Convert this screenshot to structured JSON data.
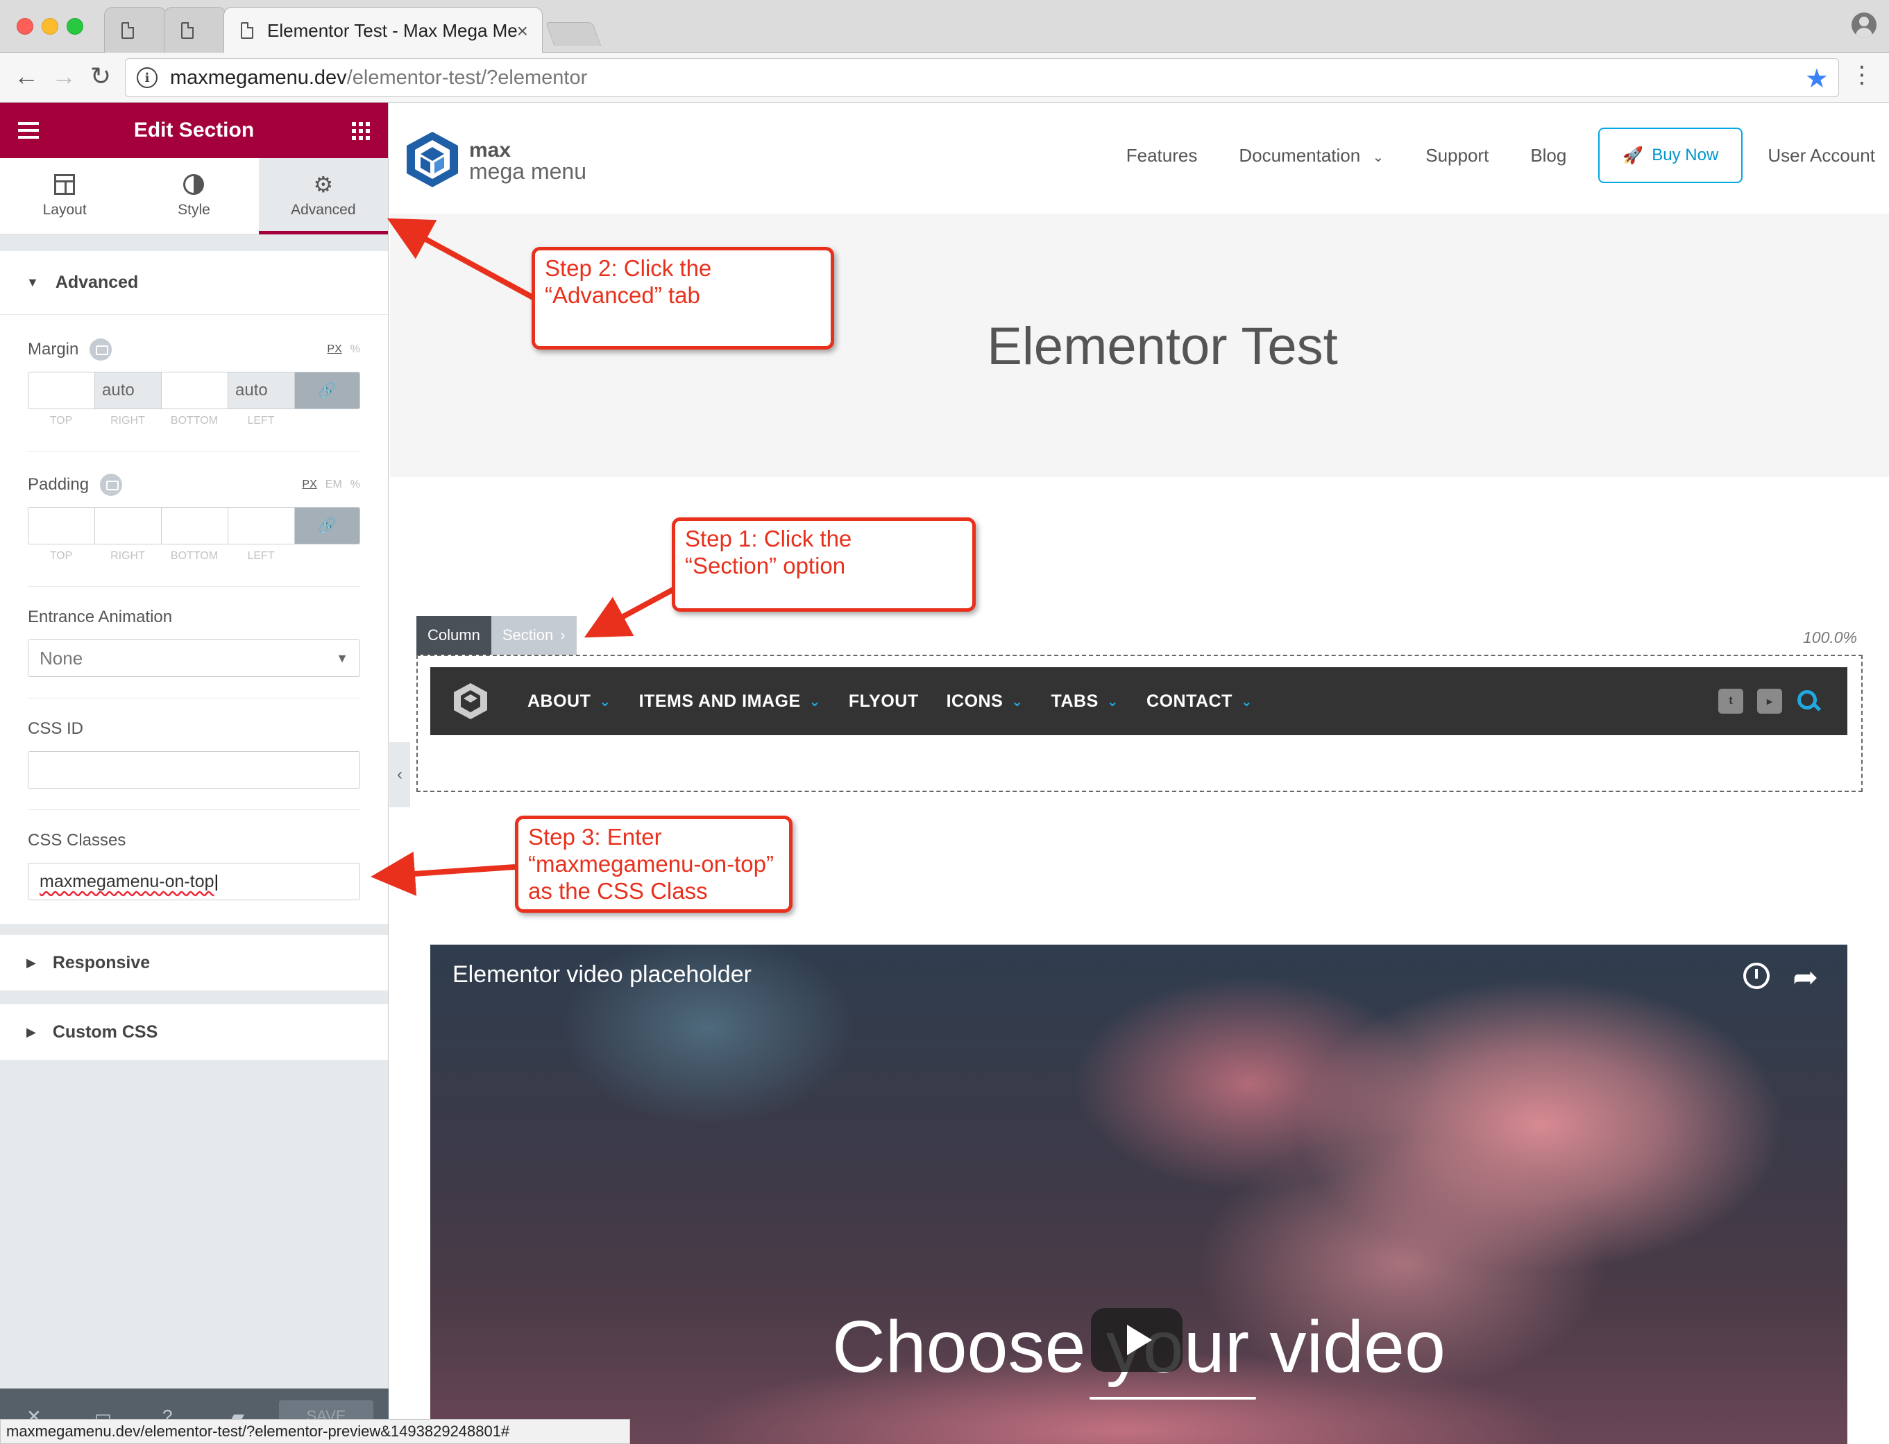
{
  "browser": {
    "tabs": [
      {
        "title": ""
      },
      {
        "title": ""
      },
      {
        "title": "Elementor Test - Max Mega Me"
      }
    ],
    "url_domain": "maxmegamenu.dev",
    "url_path": "/elementor-test/?elementor",
    "status_url": "maxmegamenu.dev/elementor-test/?elementor-preview&1493829248801#"
  },
  "panel": {
    "title": "Edit Section",
    "tabs": [
      {
        "label": "Layout",
        "icon": "layout-icon"
      },
      {
        "label": "Style",
        "icon": "style-icon"
      },
      {
        "label": "Advanced",
        "icon": "gear-icon",
        "active": true
      }
    ],
    "advanced_section": "Advanced",
    "margin": {
      "label": "Margin",
      "units": [
        "PX",
        "%"
      ],
      "values": [
        "",
        "auto",
        "",
        "auto"
      ],
      "sides": [
        "TOP",
        "RIGHT",
        "BOTTOM",
        "LEFT"
      ]
    },
    "padding": {
      "label": "Padding",
      "units": [
        "PX",
        "EM",
        "%"
      ],
      "values": [
        "",
        "",
        "",
        ""
      ],
      "sides": [
        "TOP",
        "RIGHT",
        "BOTTOM",
        "LEFT"
      ]
    },
    "entrance_animation": {
      "label": "Entrance Animation",
      "value": "None"
    },
    "css_id": {
      "label": "CSS ID",
      "value": ""
    },
    "css_classes": {
      "label": "CSS Classes",
      "value": "maxmegamenu-on-top"
    },
    "responsive_section": "Responsive",
    "custom_css_section": "Custom CSS",
    "footer": {
      "save_label": "SAVE"
    }
  },
  "site": {
    "logo_line1": "max",
    "logo_line2": "mega menu",
    "nav": [
      "Features",
      "Documentation",
      "Support",
      "Blog"
    ],
    "buy_now": "Buy Now",
    "user_account": "User Account",
    "page_title": "Elementor Test"
  },
  "editor": {
    "column_handle": "Column",
    "section_handle": "Section",
    "width_label": "100.0%"
  },
  "mega_menu": {
    "items": [
      {
        "label": "ABOUT",
        "has_sub": true
      },
      {
        "label": "ITEMS AND IMAGE",
        "has_sub": true
      },
      {
        "label": "FLYOUT",
        "has_sub": false
      },
      {
        "label": "ICONS",
        "has_sub": true
      },
      {
        "label": "TABS",
        "has_sub": true
      },
      {
        "label": "CONTACT",
        "has_sub": true
      }
    ],
    "accent": "#22a8e0"
  },
  "video": {
    "title": "Elementor video placeholder",
    "center_text": "Choose your video"
  },
  "annotations": {
    "step1_line1": "Step 1: Click the",
    "step1_line2": "“Section” option",
    "step2_line1": "Step 2: Click the",
    "step2_line2": "“Advanced” tab",
    "step3_line1": "Step 3: Enter",
    "step3_line2": "“maxmegamenu-on-top”",
    "step3_line3": "as the CSS Class",
    "color": "#e8301c"
  },
  "colors": {
    "elementor_brand": "#a4003c",
    "buy_button": "#00a8e6",
    "menu_bar": "#333333"
  }
}
